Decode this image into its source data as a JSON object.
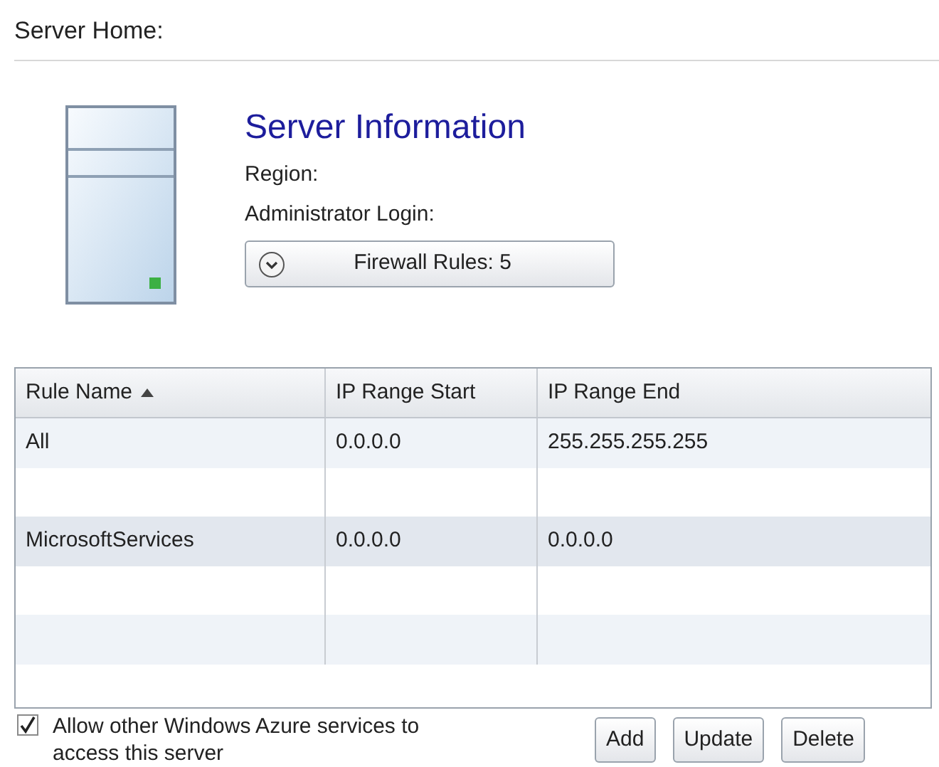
{
  "page_title": "Server Home:",
  "server": {
    "title": "Server Information",
    "fields": [
      "Region:",
      "Administrator Login:"
    ],
    "firewall_button": "Firewall Rules: 5",
    "expanded": false
  },
  "table": {
    "columns": [
      {
        "label": "Rule Name",
        "sorted": true
      },
      {
        "label": "IP Range Start",
        "sorted": false
      },
      {
        "label": "IP Range End",
        "sorted": false
      }
    ],
    "rows": [
      {
        "cells": [
          "All",
          "0.0.0.0",
          "255.255.255.255"
        ],
        "selected": false
      },
      {
        "cells": [
          "MicrosoftServices",
          "0.0.0.0",
          "0.0.0.0"
        ],
        "selected": true
      }
    ]
  },
  "allow_azure": {
    "label": "Allow other Windows Azure services to access this server",
    "checked": true
  },
  "buttons": [
    "Add",
    "Update",
    "Delete"
  ]
}
